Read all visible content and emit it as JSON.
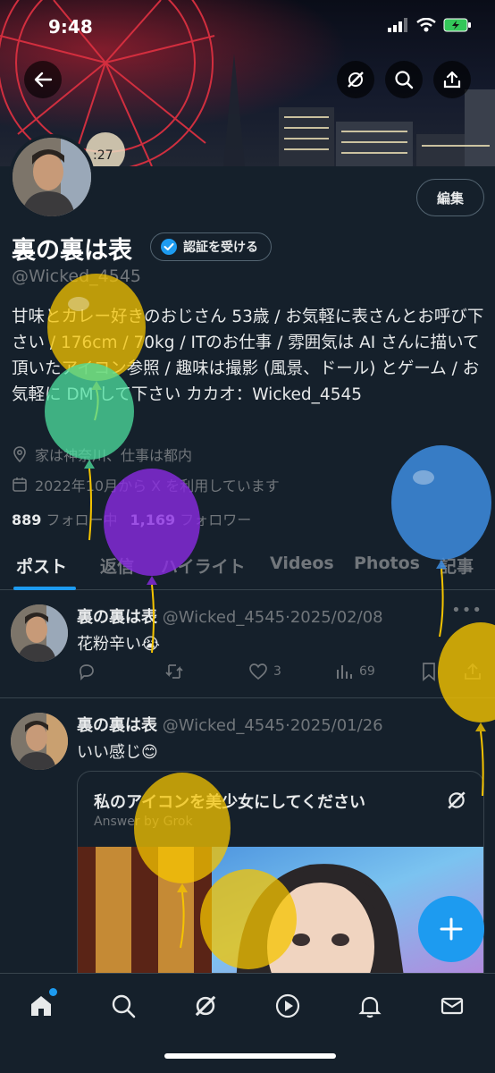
{
  "status_bar": {
    "time": "9:48"
  },
  "header": {
    "back_icon": "back-arrow-icon",
    "grok_icon": "grok-icon",
    "search_icon": "search-icon",
    "share_icon": "share-icon"
  },
  "profile": {
    "edit_label": "編集",
    "display_name": "裏の裏は表",
    "verify_label": "認証を受ける",
    "handle": "@Wicked_4545",
    "bio": "甘味とカレー好きのおじさん 53歳 / お気軽に表さんとお呼び下さい / 176cm / 70kg / ITのお仕事 / 雰囲気は AI さんに描いて頂いたアイコン参照 / 趣味は撮影 (風景、ドール) とゲーム / お気軽に DM して下さい カカオ：Wicked_4545",
    "location": "家は神奈川、仕事は都内",
    "joined": "2022年10月から X を利用しています",
    "following_count": "889",
    "following_label": "フォロー中",
    "followers_count": "1,169",
    "followers_label": "フォロワー"
  },
  "tabs": [
    "ポスト",
    "返信",
    "ハイライト",
    "Videos",
    "Photos",
    "記事"
  ],
  "posts": [
    {
      "name": "裏の裏は表",
      "handle": "@Wicked_4545",
      "date": "2025/02/08",
      "text": "花粉辛い😭",
      "likes": "3",
      "views": "69"
    },
    {
      "name": "裏の裏は表",
      "handle": "@Wicked_4545",
      "date": "2025/01/26",
      "text": "いい感じ😊",
      "card": {
        "title": "私のアイコンを美少女にしてください",
        "subtitle": "Answer by Grok"
      }
    }
  ],
  "accent_color": "#1d9bf0",
  "bottom_nav": [
    "home-icon",
    "search-icon",
    "grok-icon",
    "video-icon",
    "notifications-icon",
    "messages-icon"
  ],
  "fab_icon": "compose-plus-icon"
}
